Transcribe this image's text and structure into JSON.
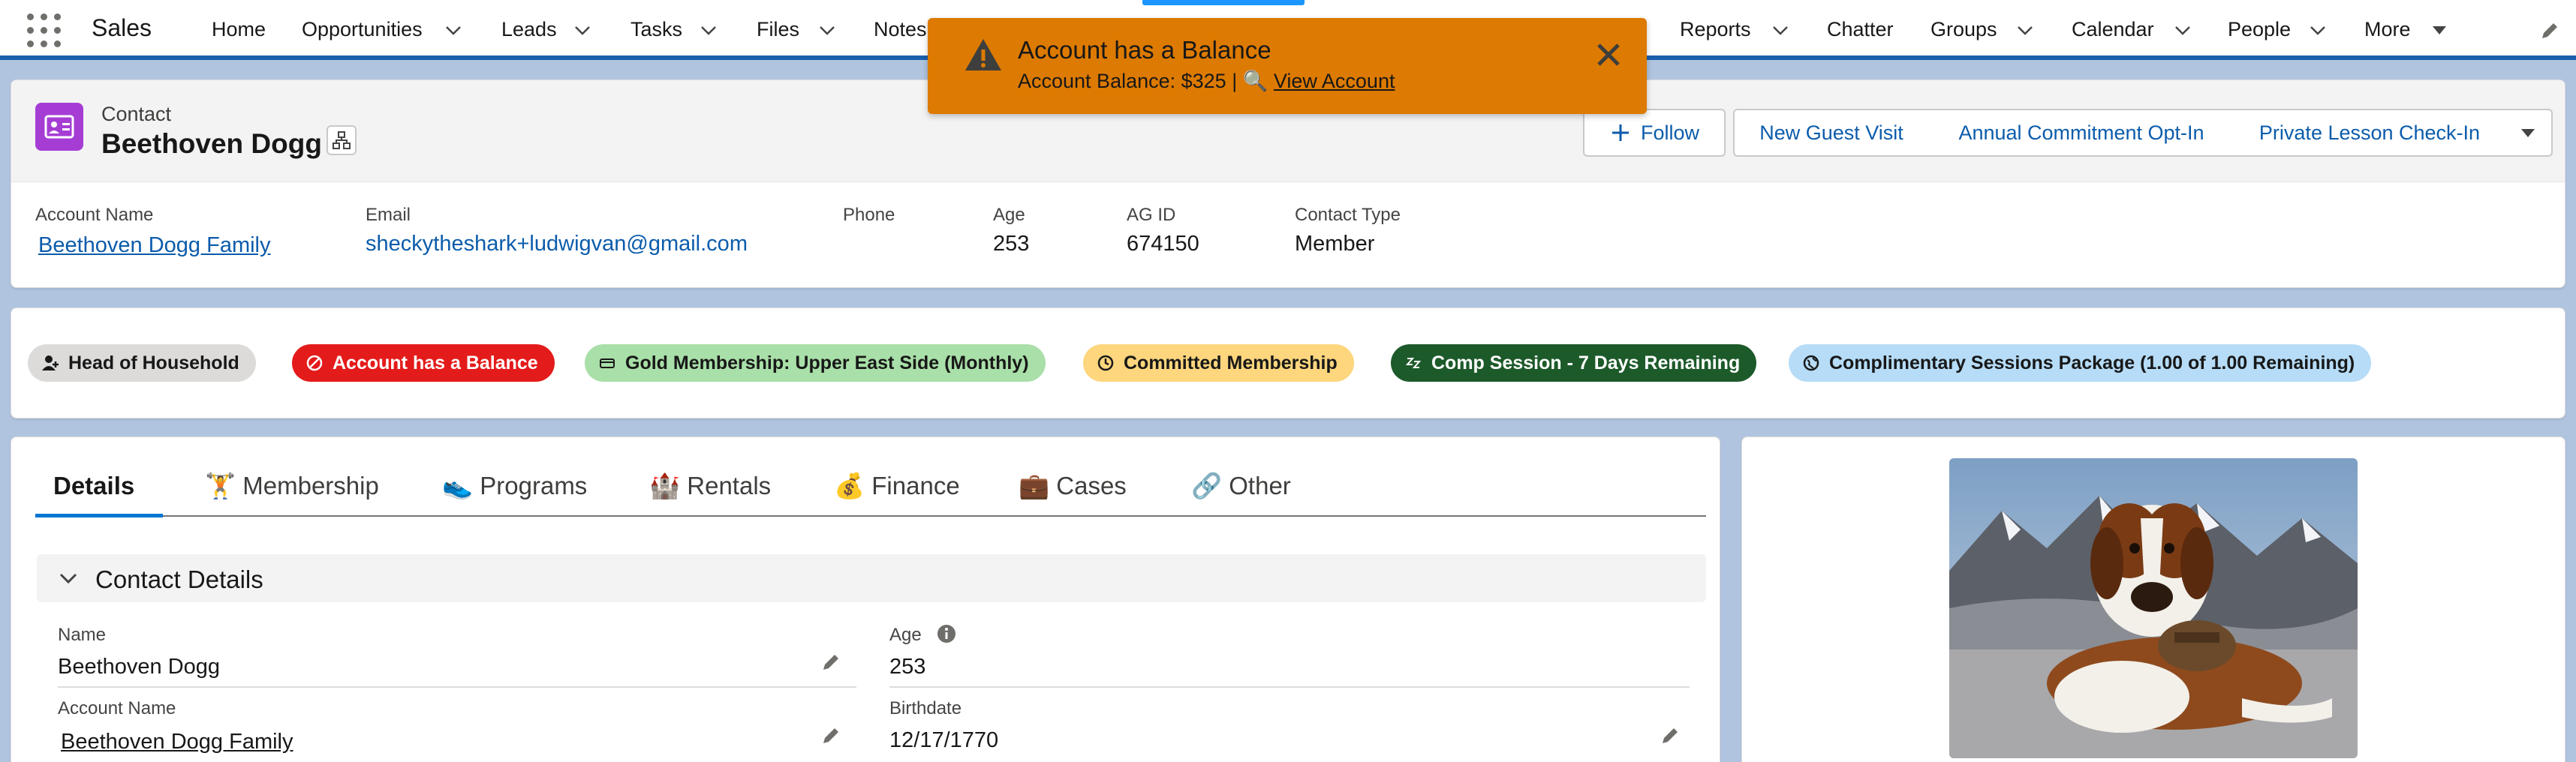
{
  "nav": {
    "app_name": "Sales",
    "items": [
      {
        "label": "Home"
      },
      {
        "label": "Opportunities"
      },
      {
        "label": "Leads"
      },
      {
        "label": "Tasks"
      },
      {
        "label": "Files"
      },
      {
        "label": "Notes"
      },
      {
        "label": "Reports"
      },
      {
        "label": "Chatter"
      },
      {
        "label": "Groups"
      },
      {
        "label": "Calendar"
      },
      {
        "label": "People"
      },
      {
        "label": "More"
      }
    ]
  },
  "toast": {
    "title": "Account has a Balance",
    "body_prefix": "Account Balance: $325 | ",
    "search_glyph": "🔍",
    "link_text": "View Account",
    "icon": "warning-icon",
    "color": "#dd7a01"
  },
  "header": {
    "object_label": "Contact",
    "record_name": "Beethoven Dogg",
    "actions": {
      "follow": "Follow",
      "new_guest_visit": "New Guest Visit",
      "annual_commitment": "Annual Commitment Opt-In",
      "private_lesson": "Private Lesson Check-In"
    },
    "fields": [
      {
        "label": "Account Name",
        "value": "Beethoven Dogg Family"
      },
      {
        "label": "Email",
        "value": "sheckytheshark+ludwigvan@gmail.com"
      },
      {
        "label": "Phone",
        "value": ""
      },
      {
        "label": "Age",
        "value": "253"
      },
      {
        "label": "AG ID",
        "value": "674150"
      },
      {
        "label": "Contact Type",
        "value": "Member"
      }
    ]
  },
  "badges": [
    {
      "label": "Head of Household",
      "bg": "#dddbda",
      "fg": "#181818",
      "icon": "household-icon"
    },
    {
      "label": "Account has a Balance",
      "bg": "#e41b1b",
      "fg": "#ffffff",
      "icon": "ban-icon"
    },
    {
      "label": "Gold Membership: Upper East Side (Monthly)",
      "bg": "#a9dfa8",
      "fg": "#181818",
      "icon": "card-icon"
    },
    {
      "label": "Committed Membership",
      "bg": "#fdd67d",
      "fg": "#181818",
      "icon": "clock-icon"
    },
    {
      "label": "Comp Session - 7 Days Remaining",
      "bg": "#1d5a2a",
      "fg": "#ffffff",
      "icon": "sleep-icon"
    },
    {
      "label": "Complimentary Sessions Package (1.00 of 1.00 Remaining)",
      "bg": "#b6dcf7",
      "fg": "#181818",
      "icon": "globe-icon"
    }
  ],
  "tabs": [
    {
      "label": "Details",
      "emoji": ""
    },
    {
      "label": "Membership",
      "emoji": "🏋"
    },
    {
      "label": "Programs",
      "emoji": "👟"
    },
    {
      "label": "Rentals",
      "emoji": "🏰"
    },
    {
      "label": "Finance",
      "emoji": "💰"
    },
    {
      "label": "Cases",
      "emoji": "💼"
    },
    {
      "label": "Other",
      "emoji": "🔗"
    }
  ],
  "details": {
    "section_title": "Contact Details",
    "name": {
      "label": "Name",
      "value": "Beethoven Dogg"
    },
    "age": {
      "label": "Age",
      "value": "253"
    },
    "account_name": {
      "label": "Account Name",
      "value": "Beethoven Dogg Family"
    },
    "birthdate": {
      "label": "Birthdate",
      "value": "12/17/1770"
    }
  },
  "photo": {
    "icon": "dog-photo"
  }
}
